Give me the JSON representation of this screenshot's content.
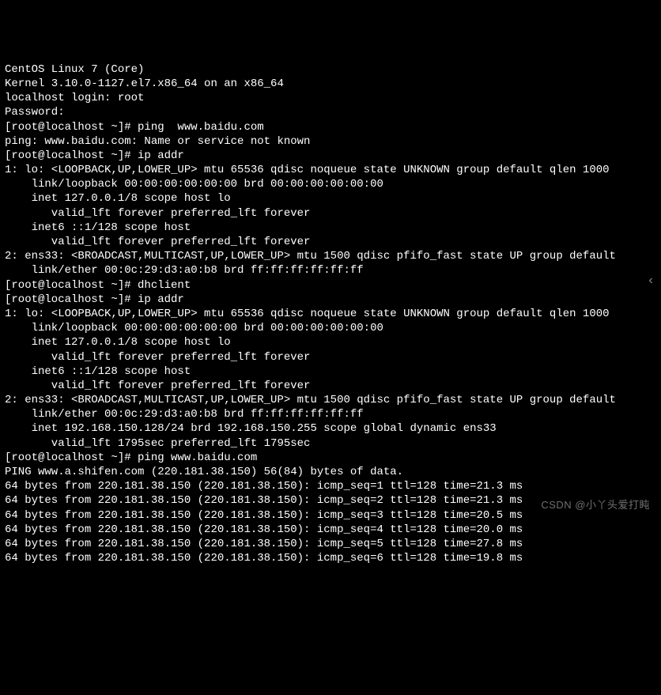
{
  "lines": [
    "CentOS Linux 7 (Core)",
    "Kernel 3.10.0-1127.el7.x86_64 on an x86_64",
    "",
    "localhost login: root",
    "Password:",
    "[root@localhost ~]# ping  www.baidu.com",
    "ping: www.baidu.com: Name or service not known",
    "[root@localhost ~]# ip addr",
    "1: lo: <LOOPBACK,UP,LOWER_UP> mtu 65536 qdisc noqueue state UNKNOWN group default qlen 1000",
    "    link/loopback 00:00:00:00:00:00 brd 00:00:00:00:00:00",
    "    inet 127.0.0.1/8 scope host lo",
    "       valid_lft forever preferred_lft forever",
    "    inet6 ::1/128 scope host",
    "       valid_lft forever preferred_lft forever",
    "2: ens33: <BROADCAST,MULTICAST,UP,LOWER_UP> mtu 1500 qdisc pfifo_fast state UP group default",
    "    link/ether 00:0c:29:d3:a0:b8 brd ff:ff:ff:ff:ff:ff",
    "[root@localhost ~]# dhclient",
    "[root@localhost ~]# ip addr",
    "1: lo: <LOOPBACK,UP,LOWER_UP> mtu 65536 qdisc noqueue state UNKNOWN group default qlen 1000",
    "    link/loopback 00:00:00:00:00:00 brd 00:00:00:00:00:00",
    "    inet 127.0.0.1/8 scope host lo",
    "       valid_lft forever preferred_lft forever",
    "    inet6 ::1/128 scope host",
    "       valid_lft forever preferred_lft forever",
    "2: ens33: <BROADCAST,MULTICAST,UP,LOWER_UP> mtu 1500 qdisc pfifo_fast state UP group default",
    "    link/ether 00:0c:29:d3:a0:b8 brd ff:ff:ff:ff:ff:ff",
    "    inet 192.168.150.128/24 brd 192.168.150.255 scope global dynamic ens33",
    "       valid_lft 1795sec preferred_lft 1795sec",
    "[root@localhost ~]# ping www.baidu.com",
    "PING www.a.shifen.com (220.181.38.150) 56(84) bytes of data.",
    "64 bytes from 220.181.38.150 (220.181.38.150): icmp_seq=1 ttl=128 time=21.3 ms",
    "64 bytes from 220.181.38.150 (220.181.38.150): icmp_seq=2 ttl=128 time=21.3 ms",
    "64 bytes from 220.181.38.150 (220.181.38.150): icmp_seq=3 ttl=128 time=20.5 ms",
    "64 bytes from 220.181.38.150 (220.181.38.150): icmp_seq=4 ttl=128 time=20.0 ms",
    "64 bytes from 220.181.38.150 (220.181.38.150): icmp_seq=5 ttl=128 time=27.8 ms",
    "64 bytes from 220.181.38.150 (220.181.38.150): icmp_seq=6 ttl=128 time=19.8 ms"
  ],
  "back_glyph": "‹",
  "watermark": "CSDN @小丫头爱打盹"
}
